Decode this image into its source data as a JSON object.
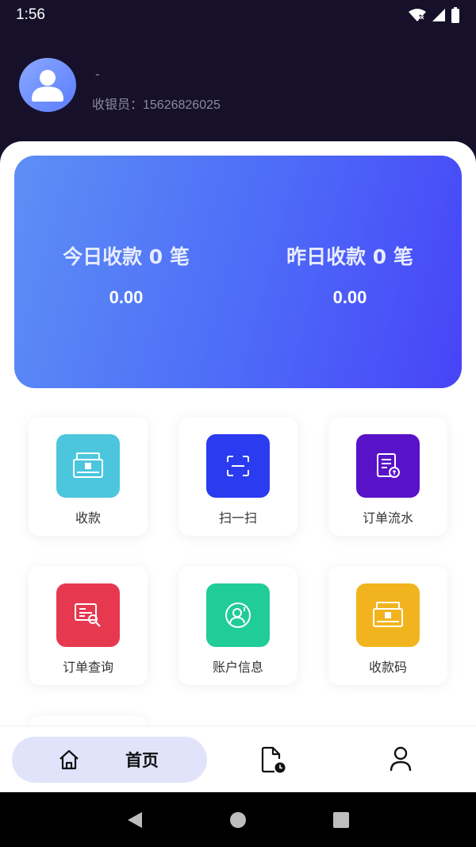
{
  "status": {
    "time": "1:56",
    "icons": [
      "wifi-icon",
      "signal-icon",
      "battery-icon"
    ]
  },
  "profile": {
    "name": "-",
    "role": "收银员：15626826025"
  },
  "summary": {
    "today_label": "今日收款 0 笔",
    "today_value": "0.00",
    "yesterday_label": "昨日收款 0 笔",
    "yesterday_value": "0.00"
  },
  "menu": [
    {
      "label": "收款",
      "icon": "cash-register-icon",
      "color": "#4cc6dc"
    },
    {
      "label": "扫一扫",
      "icon": "scan-icon",
      "color": "#2a3bf0"
    },
    {
      "label": "订单流水",
      "icon": "order-ledger-icon",
      "color": "#5813c8"
    },
    {
      "label": "订单查询",
      "icon": "order-search-icon",
      "color": "#e63950"
    },
    {
      "label": "账户信息",
      "icon": "account-icon",
      "color": "#20cc98"
    },
    {
      "label": "收款码",
      "icon": "payment-code-icon",
      "color": "#f2b41e"
    }
  ],
  "tabs": {
    "home": "首页",
    "items": [
      "home-icon",
      "bill-history-icon",
      "user-icon"
    ]
  },
  "system_nav": [
    "back-icon",
    "home-circle-icon",
    "recents-icon"
  ]
}
